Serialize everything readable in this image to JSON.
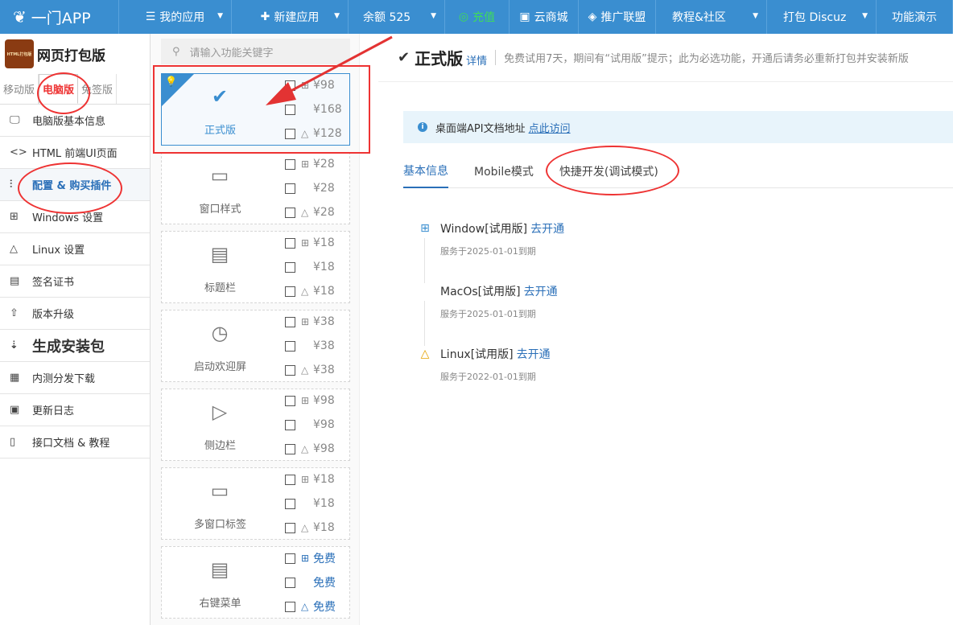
{
  "topbar": {
    "brand": "一门APP",
    "items": [
      {
        "label": "我的应用",
        "icon": "menu-icon"
      },
      {
        "label": "新建应用",
        "icon": "plus-icon"
      },
      {
        "label": "余额 525"
      },
      {
        "label": "充值",
        "icon": "yuan-icon"
      },
      {
        "label": "云商城",
        "icon": "store-icon"
      },
      {
        "label": "推广联盟",
        "icon": "diamond-icon"
      },
      {
        "label": "教程&社区"
      },
      {
        "label": "打包 Discuz"
      },
      {
        "label": "功能演示"
      }
    ]
  },
  "sidebar": {
    "product_name": "网页打包版",
    "logo_text": "HTML打包版",
    "version_tabs": [
      "移动版",
      "电脑版",
      "免签版"
    ],
    "menu": [
      {
        "label": "电脑版基本信息",
        "icon": "monitor-icon"
      },
      {
        "label": "HTML 前端UI页面",
        "icon": "code-icon"
      },
      {
        "label": "配置 & 购买插件",
        "icon": "sliders-icon"
      },
      {
        "label": "Windows 设置",
        "icon": "windows-icon"
      },
      {
        "label": "Linux 设置",
        "icon": "linux-icon"
      },
      {
        "label": "签名证书",
        "icon": "certificate-icon"
      },
      {
        "label": "版本升级",
        "icon": "upgrade-icon"
      },
      {
        "label": "生成安装包",
        "icon": "sort-icon"
      },
      {
        "label": "内测分发下载",
        "icon": "qrcode-icon"
      },
      {
        "label": "更新日志",
        "icon": "calendar-icon"
      },
      {
        "label": "接口文档 & 教程",
        "icon": "doc-code-icon"
      }
    ]
  },
  "plugins": {
    "search_placeholder": "请输入功能关键字",
    "cards": [
      {
        "name": "正式版",
        "prices": [
          "¥98",
          "¥168",
          "¥128"
        ]
      },
      {
        "name": "窗口样式",
        "prices": [
          "¥28",
          "¥28",
          "¥28"
        ]
      },
      {
        "name": "标题栏",
        "prices": [
          "¥18",
          "¥18",
          "¥18"
        ]
      },
      {
        "name": "启动欢迎屏",
        "prices": [
          "¥38",
          "¥38",
          "¥38"
        ]
      },
      {
        "name": "侧边栏",
        "prices": [
          "¥98",
          "¥98",
          "¥98"
        ]
      },
      {
        "name": "多窗口标签",
        "prices": [
          "¥18",
          "¥18",
          "¥18"
        ]
      },
      {
        "name": "右键菜单",
        "prices": [
          "免费",
          "免费",
          "免费"
        ]
      }
    ]
  },
  "main": {
    "title": "正式版",
    "detail_link": "详情",
    "description": "免费试用7天，期间有“试用版”提示；此为必选功能，开通后请务必重新打包并安装新版",
    "notice_text": "桌面端API文档地址",
    "notice_link": "点此访问",
    "tabs": [
      "基本信息",
      "Mobile模式",
      "快捷开发(调试模式)"
    ],
    "platforms": [
      {
        "name": "Window[试用版]",
        "action": "去开通",
        "expire": "服务于2025-01-01到期"
      },
      {
        "name": "MacOs[试用版]",
        "action": "去开通",
        "expire": "服务于2025-01-01到期"
      },
      {
        "name": "Linux[试用版]",
        "action": "去开通",
        "expire": "服务于2022-01-01到期"
      }
    ]
  },
  "colors": {
    "accent": "#3a8ed0",
    "annotation": "#e33333"
  }
}
